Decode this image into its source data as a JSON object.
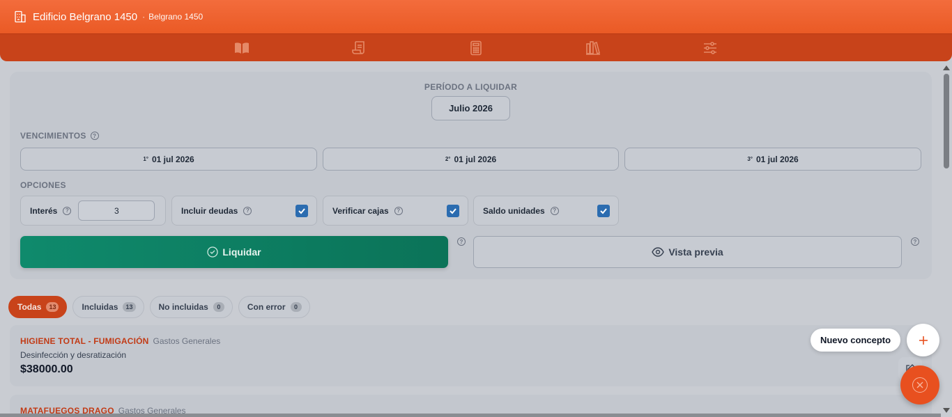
{
  "header": {
    "building_name": "Edificio Belgrano 1450",
    "separator": "·",
    "building_short": "Belgrano 1450"
  },
  "nav": {
    "icons": [
      "book-icon",
      "receipt-icon",
      "calculator-icon",
      "library-icon",
      "sliders-icon"
    ]
  },
  "period": {
    "label": "PERÍODO A LIQUIDAR",
    "value": "Julio 2026"
  },
  "vencimientos": {
    "label": "VENCIMIENTOS",
    "dates": [
      {
        "ord": "1°",
        "date": "01 jul 2026"
      },
      {
        "ord": "2°",
        "date": "01 jul 2026"
      },
      {
        "ord": "3°",
        "date": "01 jul 2026"
      }
    ]
  },
  "opciones": {
    "label": "OPCIONES",
    "interes_label": "Interés",
    "interes_value": "3",
    "incluir_deudas": "Incluir deudas",
    "verificar_cajas": "Verificar cajas",
    "saldo_unidades": "Saldo unidades"
  },
  "actions": {
    "liquidar": "Liquidar",
    "vista_previa": "Vista previa"
  },
  "filters": [
    {
      "label": "Todas",
      "count": "13",
      "active": true
    },
    {
      "label": "Incluidas",
      "count": "13",
      "active": false
    },
    {
      "label": "No incluidas",
      "count": "0",
      "active": false
    },
    {
      "label": "Con error",
      "count": "0",
      "active": false
    }
  ],
  "concepts": [
    {
      "name": "HIGIENE TOTAL - FUMIGACIÓN",
      "category": "Gastos Generales",
      "description": "Desinfección y desratización",
      "amount": "$38000.00"
    },
    {
      "name": "MATAFUEGOS DRAGO",
      "category": "Gastos Generales"
    }
  ],
  "fab": {
    "new_concept": "Nuevo concepto"
  },
  "colors": {
    "brand": "#ea5a25",
    "nav": "#c8431a",
    "liquidar": "#0f8a6c",
    "checkbox": "#2b6cb0"
  }
}
